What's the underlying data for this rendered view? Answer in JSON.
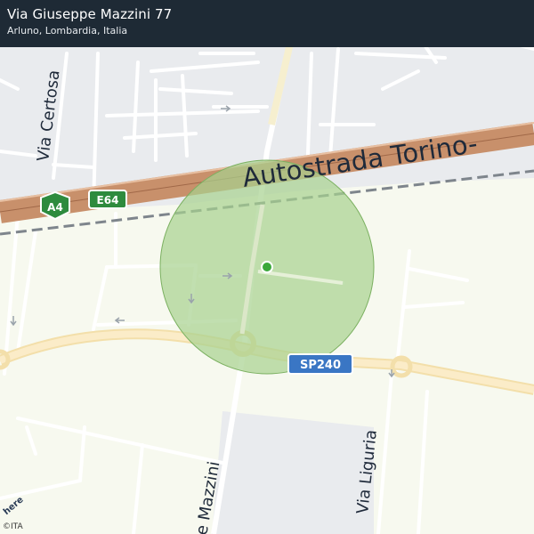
{
  "header": {
    "title": "Via Giuseppe Mazzini 77",
    "subtitle": "Arluno, Lombardia, Italia"
  },
  "map": {
    "labels": {
      "motorway": "Autostrada Torino-",
      "via_certosa": "Via Certosa",
      "via_mazzini": "e Mazzini",
      "via_liguria": "Via Liguria"
    },
    "shields": {
      "a4": "A4",
      "e64": "E64",
      "sp240": "SP240"
    },
    "colors": {
      "motorway": "#c8906b",
      "accuracy_circle": "#a7d18f",
      "location_dot": "#3aa83a",
      "header_bg": "#1e2a35"
    }
  },
  "footer": {
    "provider": "here",
    "copyright": "©ITA"
  }
}
